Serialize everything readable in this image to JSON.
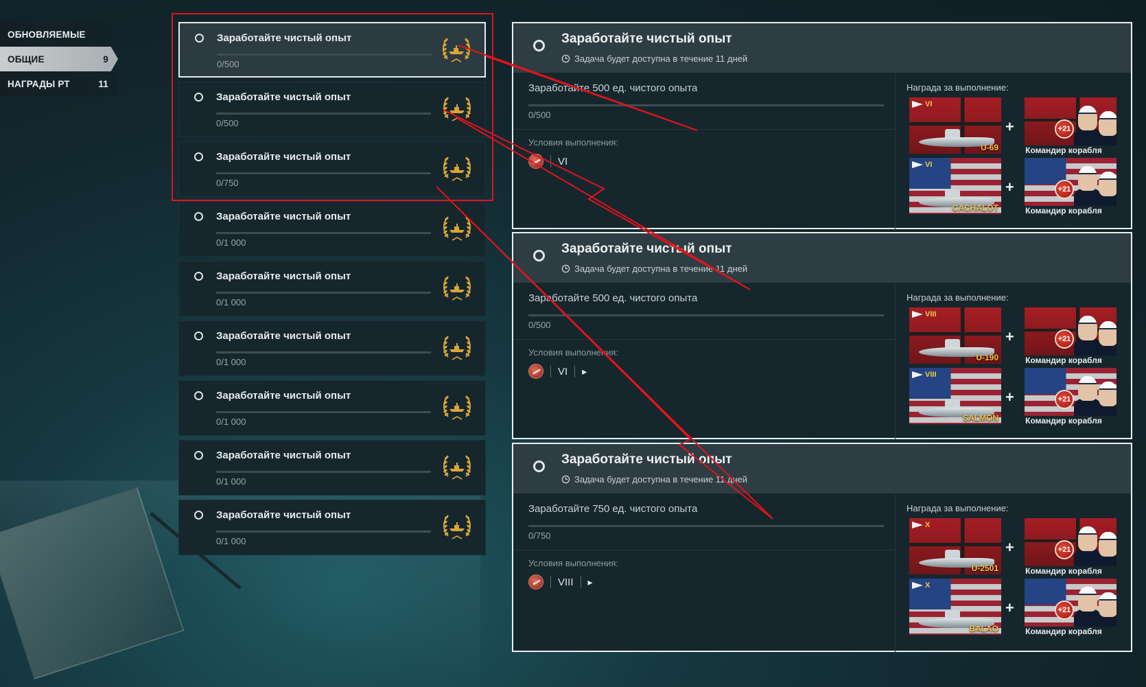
{
  "sidebar": {
    "items": [
      {
        "label": "ОБНОВЛЯЕМЫЕ",
        "count": ""
      },
      {
        "label": "ОБЩИЕ",
        "count": "9"
      },
      {
        "label": "НАГРАДЫ РТ",
        "count": "11"
      }
    ]
  },
  "tasks": [
    {
      "title": "Заработайте чистый опыт",
      "progress": "0/500"
    },
    {
      "title": "Заработайте чистый опыт",
      "progress": "0/500"
    },
    {
      "title": "Заработайте чистый опыт",
      "progress": "0/750"
    },
    {
      "title": "Заработайте чистый опыт",
      "progress": "0/1 000"
    },
    {
      "title": "Заработайте чистый опыт",
      "progress": "0/1 000"
    },
    {
      "title": "Заработайте чистый опыт",
      "progress": "0/1 000"
    },
    {
      "title": "Заработайте чистый опыт",
      "progress": "0/1 000"
    },
    {
      "title": "Заработайте чистый опыт",
      "progress": "0/1 000"
    },
    {
      "title": "Заработайте чистый опыт",
      "progress": "0/1 000"
    }
  ],
  "details": [
    {
      "title": "Заработайте чистый опыт",
      "availability": "Задача будет доступна в течение 11 дней",
      "description": "Заработайте 500 ед. чистого опыта",
      "progress": "0/500",
      "conditions_label": "Условия выполнения:",
      "condition_tier": "VI",
      "show_flag": false,
      "reward_label": "Награда за выполнение:",
      "rewards": [
        {
          "tier": "VI",
          "ship": "U-69",
          "nation": "germany",
          "commander": "Командир корабля",
          "bonus": "+21"
        },
        {
          "tier": "VI",
          "ship": "CACHALOT",
          "nation": "usa",
          "commander": "Командир корабля",
          "bonus": "+21"
        }
      ]
    },
    {
      "title": "Заработайте чистый опыт",
      "availability": "Задача будет доступна в течение 11 дней",
      "description": "Заработайте 500 ед. чистого опыта",
      "progress": "0/500",
      "conditions_label": "Условия выполнения:",
      "condition_tier": "VI",
      "show_flag": true,
      "reward_label": "Награда за выполнение:",
      "rewards": [
        {
          "tier": "VIII",
          "ship": "U-190",
          "nation": "germany",
          "commander": "Командир корабля",
          "bonus": "+21"
        },
        {
          "tier": "VIII",
          "ship": "SALMON",
          "nation": "usa",
          "commander": "Командир корабля",
          "bonus": "+21"
        }
      ]
    },
    {
      "title": "Заработайте чистый опыт",
      "availability": "Задача будет доступна в течение 11 дней",
      "description": "Заработайте 750 ед. чистого опыта",
      "progress": "0/750",
      "conditions_label": "Условия выполнения:",
      "condition_tier": "VIII",
      "show_flag": true,
      "reward_label": "Награда за выполнение:",
      "rewards": [
        {
          "tier": "X",
          "ship": "U-2501",
          "nation": "germany",
          "commander": "Командир корабля",
          "bonus": "+21"
        },
        {
          "tier": "X",
          "ship": "BALAO",
          "nation": "usa",
          "commander": "Командир корабля",
          "bonus": "+21"
        }
      ]
    }
  ],
  "colors": {
    "annotation": "#e0141c",
    "tier_gold": "#f3c74c",
    "selected_border": "#e7ecee"
  },
  "icons": [
    "radio-icon",
    "laurel-icon",
    "clock-icon",
    "submarine-class-icon",
    "pennant-icon"
  ]
}
